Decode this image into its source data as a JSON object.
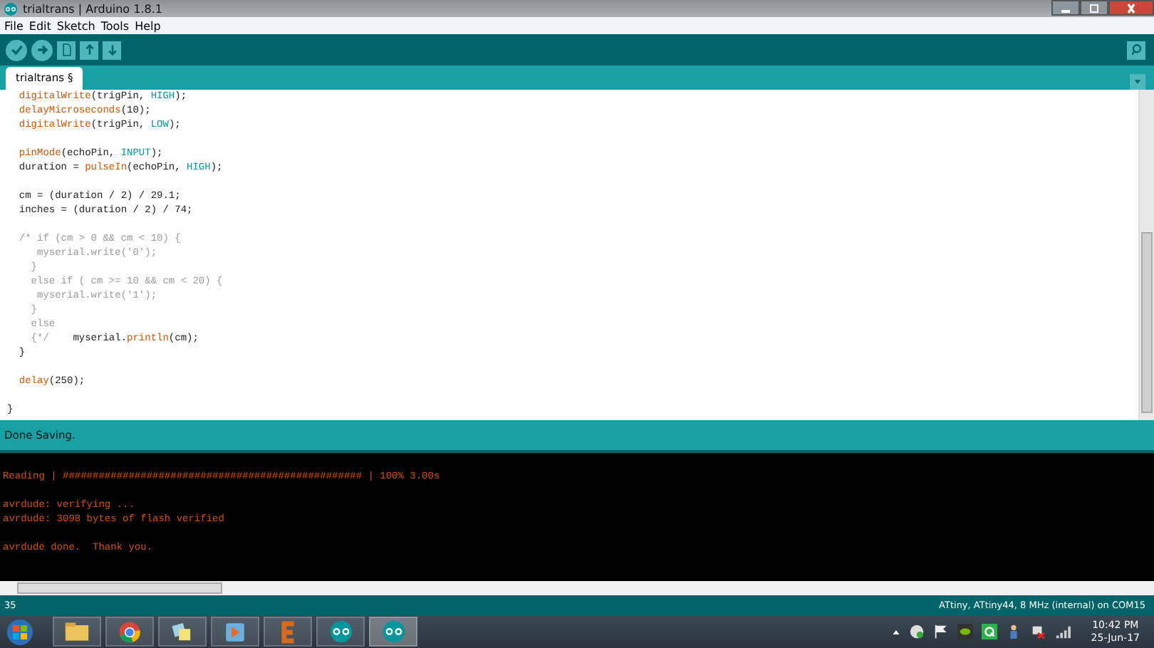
{
  "window": {
    "title": "trialtrans | Arduino 1.8.1"
  },
  "menu": [
    "File",
    "Edit",
    "Sketch",
    "Tools",
    "Help"
  ],
  "tabs": [
    {
      "label": "trialtrans §",
      "selected": true
    }
  ],
  "editor": {
    "lines": [
      {
        "kind": "code",
        "segments": [
          {
            "t": "  digitalWrite",
            "kind": "fn"
          },
          {
            "t": "(trigPin, ",
            "kind": "plain"
          },
          {
            "t": "HIGH",
            "kind": "const"
          },
          {
            "t": ");",
            "kind": "plain"
          }
        ]
      },
      {
        "kind": "code",
        "segments": [
          {
            "t": "  delayMicroseconds",
            "kind": "fn"
          },
          {
            "t": "(10);",
            "kind": "plain"
          }
        ]
      },
      {
        "kind": "code",
        "segments": [
          {
            "t": "  digitalWrite",
            "kind": "fn"
          },
          {
            "t": "(trigPin, ",
            "kind": "plain"
          },
          {
            "t": "LOW",
            "kind": "const"
          },
          {
            "t": ");",
            "kind": "plain"
          }
        ]
      },
      {
        "kind": "blank"
      },
      {
        "kind": "code",
        "segments": [
          {
            "t": "  pinMode",
            "kind": "fn"
          },
          {
            "t": "(echoPin, ",
            "kind": "plain"
          },
          {
            "t": "INPUT",
            "kind": "const"
          },
          {
            "t": ");",
            "kind": "plain"
          }
        ]
      },
      {
        "kind": "code",
        "segments": [
          {
            "t": "  duration = ",
            "kind": "plain"
          },
          {
            "t": "pulseIn",
            "kind": "fn"
          },
          {
            "t": "(echoPin, ",
            "kind": "plain"
          },
          {
            "t": "HIGH",
            "kind": "const"
          },
          {
            "t": ");",
            "kind": "plain"
          }
        ]
      },
      {
        "kind": "blank"
      },
      {
        "kind": "code",
        "segments": [
          {
            "t": "  cm = (duration / 2) / 29.1;",
            "kind": "plain"
          }
        ]
      },
      {
        "kind": "code",
        "segments": [
          {
            "t": "  inches = (duration / 2) / 74;",
            "kind": "plain"
          }
        ]
      },
      {
        "kind": "blank"
      },
      {
        "kind": "code",
        "segments": [
          {
            "t": "  /* if (cm > 0 && cm < 10) {",
            "kind": "comment"
          }
        ]
      },
      {
        "kind": "code",
        "segments": [
          {
            "t": "     myserial.write('0');",
            "kind": "comment"
          }
        ]
      },
      {
        "kind": "code",
        "segments": [
          {
            "t": "    }",
            "kind": "comment"
          }
        ]
      },
      {
        "kind": "code",
        "segments": [
          {
            "t": "    else if ( cm >= 10 && cm < 20) {",
            "kind": "comment"
          }
        ]
      },
      {
        "kind": "code",
        "segments": [
          {
            "t": "     myserial.write('1');",
            "kind": "comment"
          }
        ]
      },
      {
        "kind": "code",
        "segments": [
          {
            "t": "    }",
            "kind": "comment"
          }
        ]
      },
      {
        "kind": "code",
        "segments": [
          {
            "t": "    else",
            "kind": "comment"
          }
        ]
      },
      {
        "kind": "code",
        "segments": [
          {
            "t": "    {*/",
            "kind": "comment"
          },
          {
            "t": "    myserial.",
            "kind": "plain"
          },
          {
            "t": "println",
            "kind": "fn"
          },
          {
            "t": "(cm);",
            "kind": "plain"
          }
        ]
      },
      {
        "kind": "code",
        "segments": [
          {
            "t": "  }",
            "kind": "plain"
          }
        ]
      },
      {
        "kind": "blank"
      },
      {
        "kind": "code",
        "segments": [
          {
            "t": "  delay",
            "kind": "fn"
          },
          {
            "t": "(250);",
            "kind": "plain"
          }
        ]
      },
      {
        "kind": "blank"
      },
      {
        "kind": "code",
        "segments": [
          {
            "t": "}",
            "kind": "plain"
          }
        ]
      }
    ]
  },
  "status": "Done Saving.",
  "console": [
    {
      "kind": "blank"
    },
    {
      "kind": "text",
      "text": "Reading | ################################################## | 100% 3.00s"
    },
    {
      "kind": "blank"
    },
    {
      "kind": "text",
      "text": "avrdude: verifying ..."
    },
    {
      "kind": "text",
      "text": "avrdude: 3098 bytes of flash verified"
    },
    {
      "kind": "blank"
    },
    {
      "kind": "text",
      "text": "avrdude done.  Thank you."
    }
  ],
  "footer": {
    "line": "35",
    "board": "ATtiny, ATtiny44, 8 MHz (internal) on COM15"
  },
  "taskbar": {
    "time": "10:42 PM",
    "date": "25-Jun-17"
  }
}
